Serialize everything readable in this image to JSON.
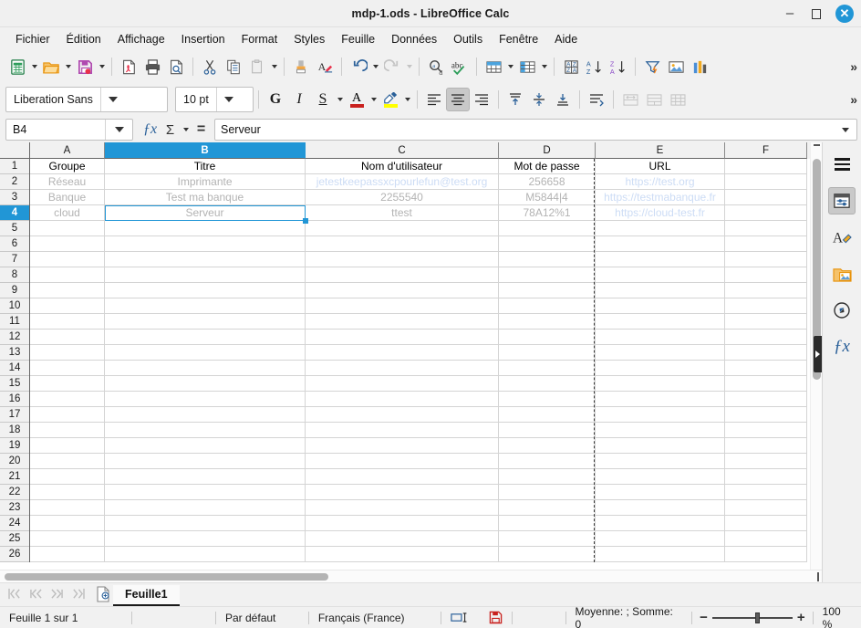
{
  "window": {
    "title": "mdp-1.ods - LibreOffice Calc",
    "minimize_label": "–",
    "close_label": "✕"
  },
  "menubar": {
    "items": [
      "Fichier",
      "Édition",
      "Affichage",
      "Insertion",
      "Format",
      "Styles",
      "Feuille",
      "Données",
      "Outils",
      "Fenêtre",
      "Aide"
    ]
  },
  "toolbar": {
    "items": [
      {
        "name": "new-document-icon"
      },
      {
        "name": "open-document-icon"
      },
      {
        "name": "save-icon"
      },
      {
        "name": "export-pdf-icon"
      },
      {
        "name": "print-icon"
      },
      {
        "name": "print-preview-icon"
      },
      {
        "name": "cut-icon"
      },
      {
        "name": "copy-icon"
      },
      {
        "name": "paste-icon"
      },
      {
        "name": "clone-formatting-icon"
      },
      {
        "name": "clear-formatting-icon"
      },
      {
        "name": "undo-icon"
      },
      {
        "name": "redo-icon"
      },
      {
        "name": "find-replace-icon"
      },
      {
        "name": "spelling-icon"
      },
      {
        "name": "insert-row-icon"
      },
      {
        "name": "insert-column-icon"
      },
      {
        "name": "sort-dialog-icon"
      },
      {
        "name": "sort-ascending-icon"
      },
      {
        "name": "sort-descending-icon"
      },
      {
        "name": "autofilter-icon"
      },
      {
        "name": "insert-image-icon"
      },
      {
        "name": "insert-chart-icon"
      }
    ],
    "overflow_label": "»"
  },
  "formatbar": {
    "font_name": "Liberation Sans",
    "font_size": "10 pt",
    "bold_label": "G",
    "italic_label": "I",
    "underline_label": "S",
    "font_color_label": "A",
    "overflow_label": "»"
  },
  "formulabar": {
    "name_box": "B4",
    "function_wizard_label": "ƒx",
    "sum_label": "Σ",
    "formula_label": "=",
    "input_line": "Serveur"
  },
  "grid": {
    "columns": [
      "A",
      "B",
      "C",
      "D",
      "E",
      "F"
    ],
    "selected_column": "B",
    "selected_row": 4,
    "active_cell": "B4",
    "rows": [
      {
        "n": 1,
        "cells": [
          {
            "v": "Groupe",
            "style": "hdr"
          },
          {
            "v": "Titre",
            "style": "hdr"
          },
          {
            "v": "Nom d'utilisateur",
            "style": "hdr"
          },
          {
            "v": "Mot de passe",
            "style": "hdr"
          },
          {
            "v": "URL",
            "style": "hdr"
          },
          {
            "v": "",
            "style": "hdr"
          }
        ]
      },
      {
        "n": 2,
        "cells": [
          {
            "v": "Réseau",
            "style": "grey"
          },
          {
            "v": "Imprimante",
            "style": "grey"
          },
          {
            "v": "jetestkeepassxcpourlefun@test.org",
            "style": "link"
          },
          {
            "v": "256658",
            "style": "grey"
          },
          {
            "v": "https://test.org",
            "style": "link"
          },
          {
            "v": "",
            "style": "grey"
          }
        ]
      },
      {
        "n": 3,
        "cells": [
          {
            "v": "Banque",
            "style": "grey"
          },
          {
            "v": "Test ma banque",
            "style": "grey"
          },
          {
            "v": "2255540",
            "style": "grey"
          },
          {
            "v": "M5844|4",
            "style": "grey"
          },
          {
            "v": "https://testmabanque.fr",
            "style": "link"
          },
          {
            "v": "",
            "style": "grey"
          }
        ]
      },
      {
        "n": 4,
        "cells": [
          {
            "v": "cloud",
            "style": "grey"
          },
          {
            "v": "Serveur",
            "style": "grey"
          },
          {
            "v": "ttest",
            "style": "grey"
          },
          {
            "v": "78A12%1",
            "style": "grey"
          },
          {
            "v": "https://cloud-test.fr",
            "style": "link"
          },
          {
            "v": "",
            "style": "grey"
          }
        ]
      },
      {
        "n": 5,
        "cells": [
          {
            "v": ""
          },
          {
            "v": ""
          },
          {
            "v": ""
          },
          {
            "v": ""
          },
          {
            "v": ""
          },
          {
            "v": ""
          }
        ]
      },
      {
        "n": 6,
        "cells": [
          {
            "v": ""
          },
          {
            "v": ""
          },
          {
            "v": ""
          },
          {
            "v": ""
          },
          {
            "v": ""
          },
          {
            "v": ""
          }
        ]
      },
      {
        "n": 7,
        "cells": [
          {
            "v": ""
          },
          {
            "v": ""
          },
          {
            "v": ""
          },
          {
            "v": ""
          },
          {
            "v": ""
          },
          {
            "v": ""
          }
        ]
      },
      {
        "n": 8,
        "cells": [
          {
            "v": ""
          },
          {
            "v": ""
          },
          {
            "v": ""
          },
          {
            "v": ""
          },
          {
            "v": ""
          },
          {
            "v": ""
          }
        ]
      },
      {
        "n": 9,
        "cells": [
          {
            "v": ""
          },
          {
            "v": ""
          },
          {
            "v": ""
          },
          {
            "v": ""
          },
          {
            "v": ""
          },
          {
            "v": ""
          }
        ]
      },
      {
        "n": 10,
        "cells": [
          {
            "v": ""
          },
          {
            "v": ""
          },
          {
            "v": ""
          },
          {
            "v": ""
          },
          {
            "v": ""
          },
          {
            "v": ""
          }
        ]
      },
      {
        "n": 11,
        "cells": [
          {
            "v": ""
          },
          {
            "v": ""
          },
          {
            "v": ""
          },
          {
            "v": ""
          },
          {
            "v": ""
          },
          {
            "v": ""
          }
        ]
      },
      {
        "n": 12,
        "cells": [
          {
            "v": ""
          },
          {
            "v": ""
          },
          {
            "v": ""
          },
          {
            "v": ""
          },
          {
            "v": ""
          },
          {
            "v": ""
          }
        ]
      },
      {
        "n": 13,
        "cells": [
          {
            "v": ""
          },
          {
            "v": ""
          },
          {
            "v": ""
          },
          {
            "v": ""
          },
          {
            "v": ""
          },
          {
            "v": ""
          }
        ]
      },
      {
        "n": 14,
        "cells": [
          {
            "v": ""
          },
          {
            "v": ""
          },
          {
            "v": ""
          },
          {
            "v": ""
          },
          {
            "v": ""
          },
          {
            "v": ""
          }
        ]
      },
      {
        "n": 15,
        "cells": [
          {
            "v": ""
          },
          {
            "v": ""
          },
          {
            "v": ""
          },
          {
            "v": ""
          },
          {
            "v": ""
          },
          {
            "v": ""
          }
        ]
      },
      {
        "n": 16,
        "cells": [
          {
            "v": ""
          },
          {
            "v": ""
          },
          {
            "v": ""
          },
          {
            "v": ""
          },
          {
            "v": ""
          },
          {
            "v": ""
          }
        ]
      },
      {
        "n": 17,
        "cells": [
          {
            "v": ""
          },
          {
            "v": ""
          },
          {
            "v": ""
          },
          {
            "v": ""
          },
          {
            "v": ""
          },
          {
            "v": ""
          }
        ]
      },
      {
        "n": 18,
        "cells": [
          {
            "v": ""
          },
          {
            "v": ""
          },
          {
            "v": ""
          },
          {
            "v": ""
          },
          {
            "v": ""
          },
          {
            "v": ""
          }
        ]
      },
      {
        "n": 19,
        "cells": [
          {
            "v": ""
          },
          {
            "v": ""
          },
          {
            "v": ""
          },
          {
            "v": ""
          },
          {
            "v": ""
          },
          {
            "v": ""
          }
        ]
      },
      {
        "n": 20,
        "cells": [
          {
            "v": ""
          },
          {
            "v": ""
          },
          {
            "v": ""
          },
          {
            "v": ""
          },
          {
            "v": ""
          },
          {
            "v": ""
          }
        ]
      },
      {
        "n": 21,
        "cells": [
          {
            "v": ""
          },
          {
            "v": ""
          },
          {
            "v": ""
          },
          {
            "v": ""
          },
          {
            "v": ""
          },
          {
            "v": ""
          }
        ]
      },
      {
        "n": 22,
        "cells": [
          {
            "v": ""
          },
          {
            "v": ""
          },
          {
            "v": ""
          },
          {
            "v": ""
          },
          {
            "v": ""
          },
          {
            "v": ""
          }
        ]
      },
      {
        "n": 23,
        "cells": [
          {
            "v": ""
          },
          {
            "v": ""
          },
          {
            "v": ""
          },
          {
            "v": ""
          },
          {
            "v": ""
          },
          {
            "v": ""
          }
        ]
      },
      {
        "n": 24,
        "cells": [
          {
            "v": ""
          },
          {
            "v": ""
          },
          {
            "v": ""
          },
          {
            "v": ""
          },
          {
            "v": ""
          },
          {
            "v": ""
          }
        ]
      },
      {
        "n": 25,
        "cells": [
          {
            "v": ""
          },
          {
            "v": ""
          },
          {
            "v": ""
          },
          {
            "v": ""
          },
          {
            "v": ""
          },
          {
            "v": ""
          }
        ]
      },
      {
        "n": 26,
        "cells": [
          {
            "v": ""
          },
          {
            "v": ""
          },
          {
            "v": ""
          },
          {
            "v": ""
          },
          {
            "v": ""
          },
          {
            "v": ""
          }
        ]
      }
    ]
  },
  "sidebar": {
    "items": [
      {
        "name": "sidebar-settings-icon",
        "label": "Paramètres de la barre latérale"
      },
      {
        "name": "sidebar-properties-icon",
        "label": "Propriétés",
        "active": true
      },
      {
        "name": "sidebar-styles-icon",
        "label": "Styles"
      },
      {
        "name": "sidebar-gallery-icon",
        "label": "Galerie"
      },
      {
        "name": "sidebar-navigator-icon",
        "label": "Navigateur"
      },
      {
        "name": "sidebar-functions-icon",
        "label": "Fonctions"
      }
    ]
  },
  "sheettabs": {
    "first_label": "⏮",
    "prev_label": "◀",
    "next_label": "▶",
    "last_label": "⏭",
    "add_label": "+",
    "tabs": [
      {
        "label": "Feuille1",
        "active": true
      }
    ]
  },
  "statusbar": {
    "sheet_info": "Feuille 1 sur 1",
    "page_style": "Par défaut",
    "language": "Français (France)",
    "insert_mode_icon": "selection-mode-icon",
    "save_status_icon": "unsaved-changes-icon",
    "selection_info": "Moyenne: ; Somme: 0",
    "zoom_out_label": "−",
    "zoom_in_label": "+",
    "zoom_level": "100 %"
  },
  "colors": {
    "accent": "#2196d6",
    "header_bg": "#f1f1f1",
    "grey_text": "#b3b3b3",
    "link_text": "#ccdcf5"
  }
}
